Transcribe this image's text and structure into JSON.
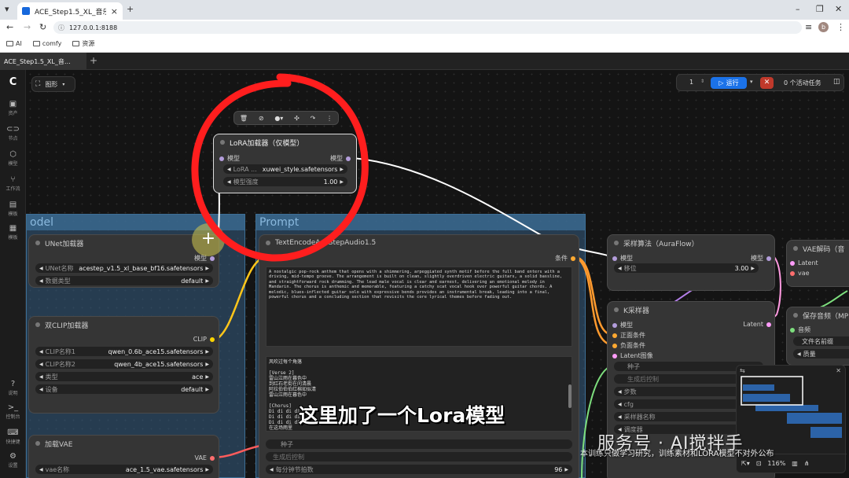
{
  "browser": {
    "tab_title": "ACE_Step1.5_XL_音乐生成工作流",
    "url": "127.0.0.1:8188",
    "bookmarks": [
      "AI",
      "comfy",
      "资源"
    ],
    "profile": "b"
  },
  "app": {
    "tab": "ACE_Step1.5_XL_音…",
    "graph_label": "图形",
    "run": {
      "count": "1",
      "run_label": "运行",
      "active_tasks": "0 个活动任务"
    },
    "sidebar": [
      "资产",
      "节点",
      "模型",
      "工作流",
      "模板"
    ],
    "sidebar_bottom": [
      "说明",
      "控制台",
      "快捷键",
      "设置"
    ],
    "zoom": "116%"
  },
  "groups": {
    "model": "odel",
    "prompt": "Prompt"
  },
  "nodes": {
    "lora": {
      "title": "LoRA加载器（仅模型）",
      "in": "模型",
      "out": "模型",
      "w1_label": "LoRA ...",
      "w1_value": "xuwei_style.safetensors",
      "w2_label": "模型强度",
      "w2_value": "1.00"
    },
    "unet": {
      "title": "UNet加载器",
      "out": "模型",
      "w1_label": "UNet名称",
      "w1_value": "acestep_v1.5_xl_base_bf16.safetensors",
      "w2_label": "数据类型",
      "w2_value": "default"
    },
    "clip": {
      "title": "双CLIP加载器",
      "out": "CLIP",
      "w1_label": "CLIP名称1",
      "w1_value": "qwen_0.6b_ace15.safetensors",
      "w2_label": "CLIP名称2",
      "w2_value": "qwen_4b_ace15.safetensors",
      "w3_label": "类型",
      "w3_value": "ace",
      "w4_label": "设备",
      "w4_value": "default"
    },
    "vae": {
      "title": "加载VAE",
      "out": "VAE",
      "w1_label": "vae名称",
      "w1_value": "ace_1.5_vae.safetensors"
    },
    "text": {
      "title": "TextEncodeAceStepAudio1.5",
      "in": "clip",
      "out": "条件",
      "prompt": "A nostalgic pop-rock anthem that opens with a shimmering, arpeggiated synth motif before the full band enters with a driving, mid-tempo groove. The arrangement is built on clean, slightly overdriven electric guitars, a solid bassline, and straightforward rock drumming. The lead male vocal is clear and earnest, delivering an emotional melody in Mandarin. The chorus is anthemic and memorable, featuring a catchy scat vocal hook over powerful guitar chords. A melodic, blues-inflected guitar solo with expressive bends provides an instrumental break, leading into a final, powerful chorus and a concluding section that revisits the core lyrical themes before fading out.",
      "lyrics": "风吹过每个角落\n\n[Verse 2]\n雷山泣雨在暮色中\n到红石老街在问清晨\n阿拉伯伯伯红棉如似清\n雷山泣雨在暮色中\n\n[Chorus]\nDi di di di ...\nDi di di di ...\nDi di di di ...\n在这场雨里",
      "w_seed": "种子",
      "w_ctrl": "生成后控制",
      "w_bpm_label": "每分钟节拍数",
      "w_bpm": "96"
    },
    "sampling": {
      "title": "采样算法（AuraFlow）",
      "in": "模型",
      "out": "模型",
      "w1_label": "移位",
      "w1_value": "3.00"
    },
    "ksampler": {
      "title": "K采样器",
      "in1": "模型",
      "in2": "正面条件",
      "in3": "负面条件",
      "in4": "Latent图像",
      "out": "Latent",
      "w1": "种子",
      "w2": "生成后控制",
      "w3": "步数",
      "w4": "cfg",
      "w5": "采样器名称",
      "w6": "调度器",
      "w6_value": "si"
    },
    "vaedecode": {
      "title": "VAE解码（音",
      "in1": "Latent",
      "in2": "vae"
    },
    "saveaudio": {
      "title": "保存音频（MP3",
      "in": "音频",
      "w1": "文件名前缀",
      "w2": "质量"
    }
  },
  "overlay": {
    "caption": "这里加了一个Lora模型",
    "watermark": "服务号 · AI搅拌手",
    "footnote": "本训练只做学习研究，训练素材和LORA模型不对外公布"
  }
}
